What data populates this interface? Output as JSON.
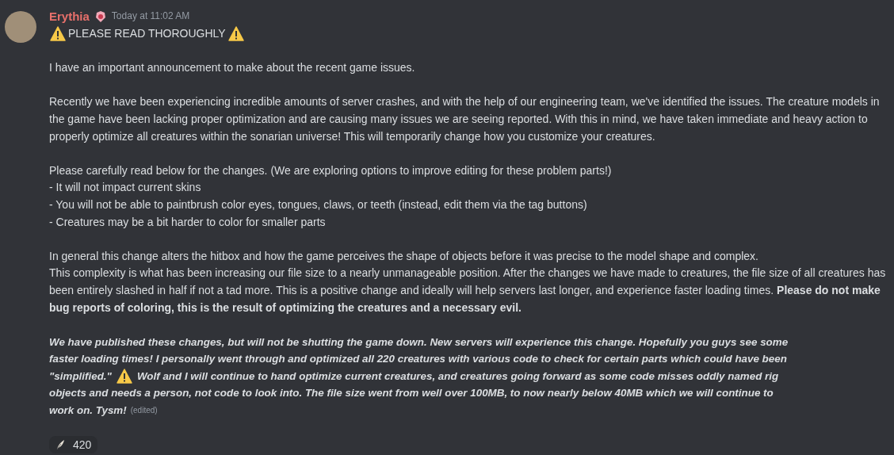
{
  "message": {
    "author": "Erythia",
    "timestamp": "Today at 11:02 AM",
    "title": "PLEASE READ THOROUGHLY",
    "paragraphs": [
      {
        "kind": "text",
        "lines": [
          "I have an important announcement to make about the recent game issues."
        ]
      },
      {
        "kind": "text",
        "lines": [
          "Recently we have been experiencing incredible amounts of server crashes, and with the help of our engineering team, we've identified the issues. The creature models in the game have been lacking proper optimization and are causing many issues we are seeing reported. With this in mind, we have taken immediate and heavy action to properly optimize all creatures within the sonarian universe! This will temporarily change how you customize your creatures."
        ]
      },
      {
        "kind": "text",
        "lines": [
          "Please carefully read below for the changes. (We are exploring options to improve editing for these problem parts!)",
          "- It will not impact current skins",
          "- You will not be able to paintbrush color eyes, tongues, claws, or teeth (instead, edit them via the tag buttons)",
          "- Creatures may be a bit harder to color for smaller parts"
        ]
      },
      {
        "kind": "text",
        "lines": [
          "In general this change alters the hitbox and how the game perceives the shape of objects before it was precise to the model shape and complex.",
          "This complexity is what has been increasing our file size to a nearly unmanageable position. After the changes we have made to creatures, the file size of all creatures has been entirely slashed in half if not a tad more. This is a positive change and ideally will help servers last longer, and experience faster loading times. **Please do not make bug reports of coloring, this is the result of optimizing the creatures and a necessary evil.**"
        ]
      },
      {
        "kind": "emphasis",
        "lines": [
          [
            "We have published these changes, but will not be shutting the game down. New servers will experience this change. Hopefully you guys see some"
          ],
          [
            "faster loading times! I personally went through and optimized all 220 creatures with various code to check for certain parts which could have been"
          ],
          [
            "\"simplified.\"",
            "Wolf and I will continue to hand optimize current creatures, and creatures going forward as some code misses oddly named rig"
          ],
          [
            "objects and needs a person, not code to look into. The file size went from well over 100MB, to now nearly below 40MB which we will continue to"
          ],
          [
            "work on. Tysm!"
          ]
        ],
        "edited": "(edited)"
      }
    ],
    "reactions": [
      {
        "count": "420"
      }
    ]
  }
}
